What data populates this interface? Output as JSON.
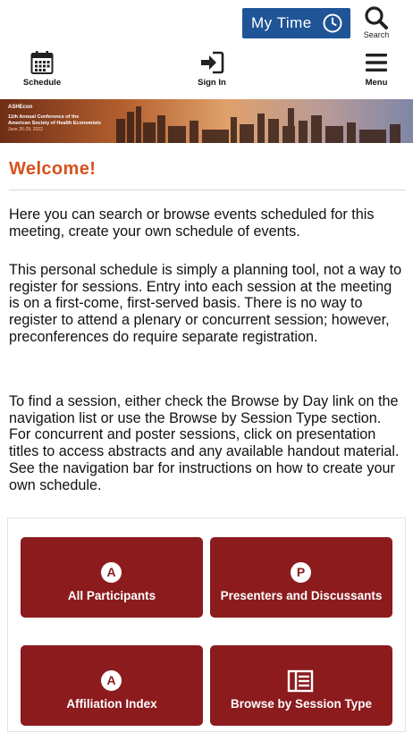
{
  "header": {
    "my_time_label": "My Time",
    "search_label": "Search",
    "nav": [
      {
        "label": "Schedule",
        "icon": "calendar-icon"
      },
      {
        "label": "Sign In",
        "icon": "sign-in-icon"
      },
      {
        "label": "Menu",
        "icon": "hamburger-menu-icon"
      }
    ],
    "accent_color": "#1f5497"
  },
  "banner": {
    "logo_text": "ASHEcon",
    "conference_line1": "11th Annual Conference of the",
    "conference_line2": "American Society of Health Economists",
    "dates": "June 26-29, 2022"
  },
  "main": {
    "title": "Welcome!",
    "title_color": "#d8511d",
    "paragraphs": [
      "Here you can search or browse events scheduled for this meeting, create your own schedule of events.",
      "This personal schedule is simply a planning tool, not a way to register for sessions. Entry into each session at the meeting is on a first-come, first-served basis. There is no way to register to attend a plenary or concurrent session; however, preconferences do require separate registration.",
      "To find a session, either check the Browse by Day link on the navigation list or use the Browse by Session Type section. For concurrent and poster sessions, click on presentation titles to access abstracts and any available handout material. See the navigation bar for instructions on how to create your own schedule."
    ]
  },
  "tiles": [
    {
      "label": "All Participants",
      "badge": "A"
    },
    {
      "label": "Presenters and Discussants",
      "badge": "P"
    },
    {
      "label": "Affiliation Index",
      "badge": "A"
    },
    {
      "label": "Browse by Session Type",
      "icon": "list-icon"
    }
  ],
  "tile_color": "#8b1b1d"
}
